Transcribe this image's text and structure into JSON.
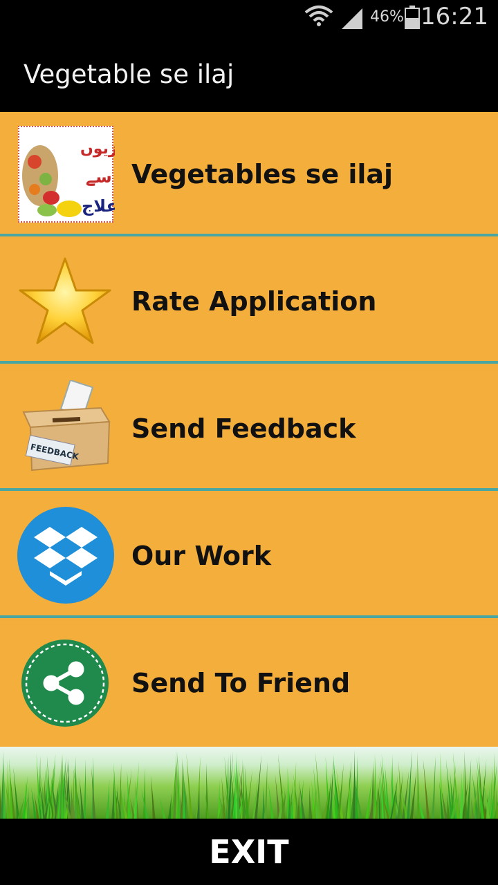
{
  "status_bar": {
    "battery_percent": "46%",
    "time": "16:21",
    "icons": [
      "wifi-icon",
      "signal-icon",
      "battery-icon"
    ]
  },
  "app_bar": {
    "title": "Vegetable se ilaj"
  },
  "menu": {
    "items": [
      {
        "label": "Vegetables se ilaj",
        "icon": "vegetables-app-logo-icon",
        "icon_text": [
          "سبزیوں",
          "سے",
          "علاج"
        ]
      },
      {
        "label": "Rate Application",
        "icon": "star-icon"
      },
      {
        "label": "Send Feedback",
        "icon": "feedback-box-icon",
        "icon_text": "FEEDBACK"
      },
      {
        "label": "Our Work",
        "icon": "dropbox-icon"
      },
      {
        "label": "Send To Friend",
        "icon": "share-icon"
      }
    ]
  },
  "footer": {
    "exit_label": "EXIT"
  },
  "colors": {
    "menu_background": "#f4ae3c",
    "divider": "#4aa6a2",
    "bar_background": "#000000",
    "dropbox_blue": "#1e8fd8",
    "share_green": "#1f8a4c"
  }
}
